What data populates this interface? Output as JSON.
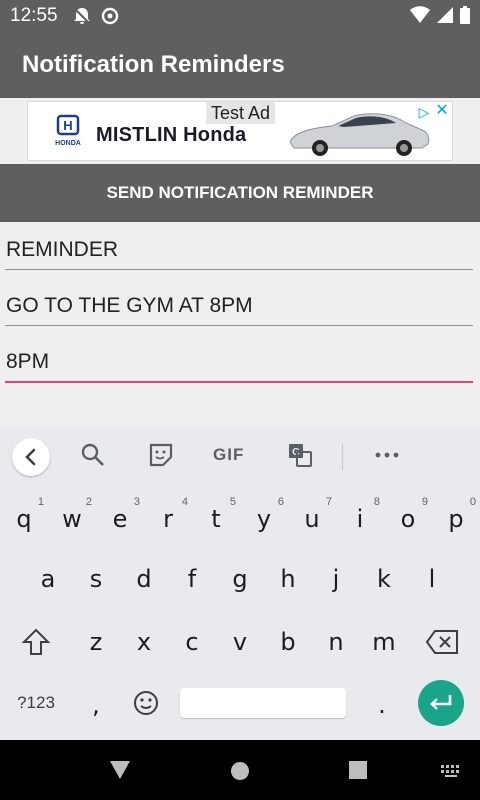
{
  "status_bar": {
    "time": "12:55"
  },
  "app_bar": {
    "title": "Notification Reminders"
  },
  "ad": {
    "label": "Test Ad",
    "advertiser": "MISTLIN Honda",
    "brand": "HONDA"
  },
  "send_button": {
    "label": "SEND NOTIFICATION REMINDER"
  },
  "form": {
    "title_value": "REMINDER",
    "message_value": "GO TO THE GYM AT 8PM",
    "time_value": "8PM"
  },
  "keyboard": {
    "toolbar": {
      "gif_label": "GIF"
    },
    "row1": [
      {
        "k": "q",
        "h": "1"
      },
      {
        "k": "w",
        "h": "2"
      },
      {
        "k": "e",
        "h": "3"
      },
      {
        "k": "r",
        "h": "4"
      },
      {
        "k": "t",
        "h": "5"
      },
      {
        "k": "y",
        "h": "6"
      },
      {
        "k": "u",
        "h": "7"
      },
      {
        "k": "i",
        "h": "8"
      },
      {
        "k": "o",
        "h": "9"
      },
      {
        "k": "p",
        "h": "0"
      }
    ],
    "row2": [
      "a",
      "s",
      "d",
      "f",
      "g",
      "h",
      "j",
      "k",
      "l"
    ],
    "row3": [
      "z",
      "x",
      "c",
      "v",
      "b",
      "n",
      "m"
    ],
    "symbols_label": "?123",
    "comma": ",",
    "period": "."
  },
  "colors": {
    "bar_gray": "#5f5f5f",
    "focus_accent": "#e0457b",
    "enter_key": "#1aa489",
    "keyboard_bg": "#e8eaed"
  }
}
